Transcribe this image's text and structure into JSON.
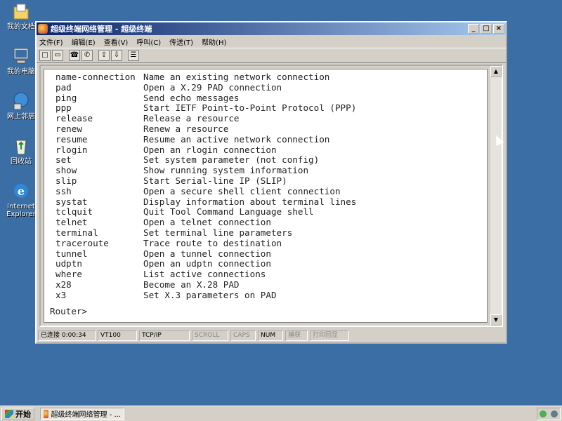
{
  "desktop": {
    "icons": [
      {
        "label": "我的文档",
        "icon": "my-documents-icon"
      },
      {
        "label": "我的电脑",
        "icon": "my-computer-icon"
      },
      {
        "label": "网上邻居",
        "icon": "network-neighborhood-icon"
      },
      {
        "label": "回收站",
        "icon": "recycle-bin-icon"
      },
      {
        "label": "Internet",
        "label2": "Explorer",
        "icon": "ie-icon"
      }
    ]
  },
  "window": {
    "title": "超级终端网络管理 - 超级终端",
    "controls": {
      "minimize": "_",
      "maximize": "□",
      "close": "×"
    }
  },
  "menu": {
    "items": [
      "文件(F)",
      "编辑(E)",
      "查看(V)",
      "呼叫(C)",
      "传送(T)",
      "帮助(H)"
    ]
  },
  "toolbar": {
    "buttons": [
      "new-icon",
      "open-icon",
      "disconnect-icon",
      "connect-icon",
      "send-icon",
      "receive-icon",
      "properties-icon"
    ]
  },
  "terminal": {
    "commands": [
      {
        "name": "name-connection",
        "desc": "Name an existing network connection"
      },
      {
        "name": "pad",
        "desc": "Open a X.29 PAD connection"
      },
      {
        "name": "ping",
        "desc": "Send echo messages"
      },
      {
        "name": "ppp",
        "desc": "Start IETF Point-to-Point Protocol (PPP)"
      },
      {
        "name": "release",
        "desc": "Release a resource"
      },
      {
        "name": "renew",
        "desc": "Renew a resource"
      },
      {
        "name": "resume",
        "desc": "Resume an active network connection"
      },
      {
        "name": "rlogin",
        "desc": "Open an rlogin connection"
      },
      {
        "name": "set",
        "desc": "Set system parameter (not config)"
      },
      {
        "name": "show",
        "desc": "Show running system information"
      },
      {
        "name": "slip",
        "desc": "Start Serial-line IP (SLIP)"
      },
      {
        "name": "ssh",
        "desc": "Open a secure shell client connection"
      },
      {
        "name": "systat",
        "desc": "Display information about terminal lines"
      },
      {
        "name": "tclquit",
        "desc": "Quit Tool Command Language shell"
      },
      {
        "name": "telnet",
        "desc": "Open a telnet connection"
      },
      {
        "name": "terminal",
        "desc": "Set terminal line parameters"
      },
      {
        "name": "traceroute",
        "desc": "Trace route to destination"
      },
      {
        "name": "tunnel",
        "desc": "Open a tunnel connection"
      },
      {
        "name": "udptn",
        "desc": "Open an udptn connection"
      },
      {
        "name": "where",
        "desc": "List active connections"
      },
      {
        "name": "x28",
        "desc": "Become an X.28 PAD"
      },
      {
        "name": "x3",
        "desc": "Set X.3 parameters on PAD"
      }
    ],
    "prompt": "Router>"
  },
  "statusbar": {
    "connected": "已连接 0:00:34",
    "emulation": "VT100",
    "protocol": "TCP/IP",
    "scroll": "SCROLL",
    "caps": "CAPS",
    "num": "NUM",
    "capture": "捕获",
    "print_echo": "打印回显"
  },
  "taskbar": {
    "start": "开始",
    "task_label": "超级终端网络管理 - ..."
  }
}
